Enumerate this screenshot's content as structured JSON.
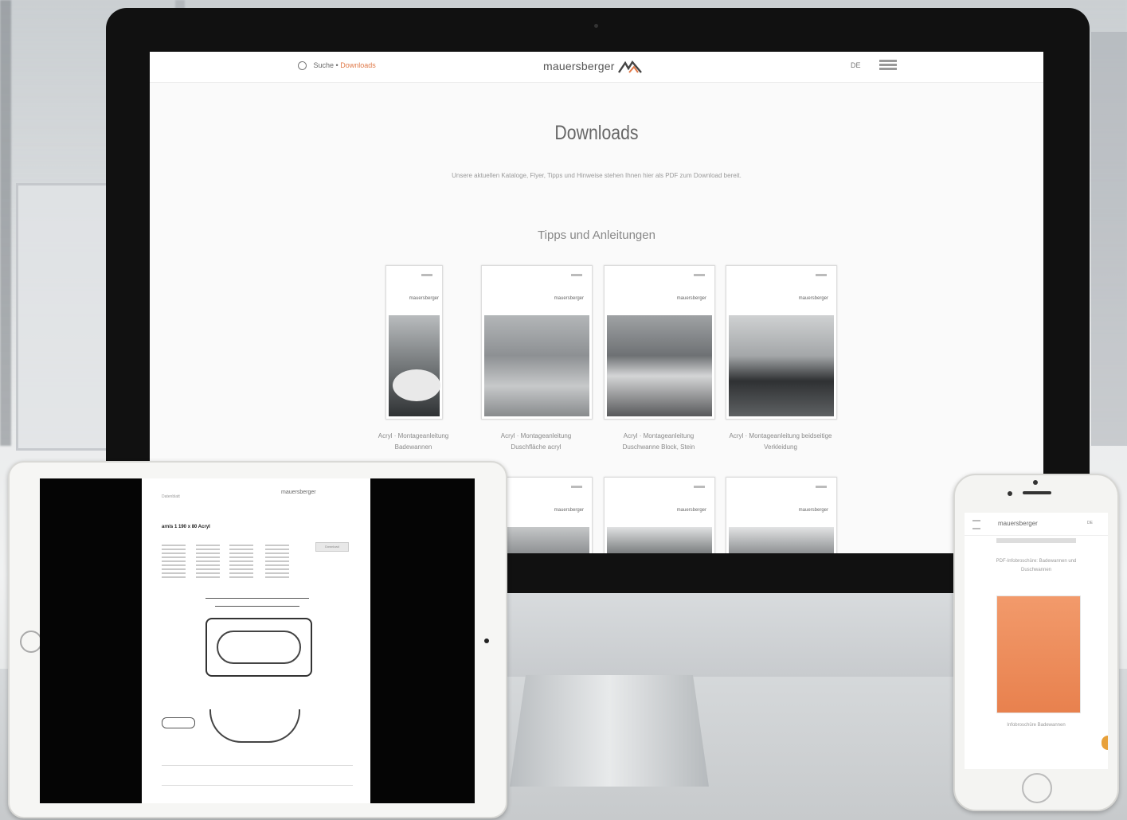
{
  "desktop": {
    "nav": {
      "search_label": "Suche",
      "crumb_sep": " • ",
      "crumb_current": "Downloads",
      "logo_text": "mauersberger",
      "lang": "DE"
    },
    "page_title": "Downloads",
    "page_subtitle": "Unsere aktuellen Kataloge, Flyer, Tipps und Hinweise stehen Ihnen hier als PDF zum Download bereit.",
    "section_title": "Tipps und Anleitungen",
    "cards": [
      {
        "label": "Acryl · Montageanleitung Badewannen"
      },
      {
        "label": "Acryl · Montageanleitung Duschfläche acryl"
      },
      {
        "label": "Acryl · Montageanleitung Duschwanne Block, Stein"
      },
      {
        "label": "Acryl · Montageanleitung beidseitige Verkleidung"
      }
    ],
    "card_brand": "mauersberger"
  },
  "tablet": {
    "pdf_header": "Datenblatt",
    "pdf_logo": "mauersberger",
    "pdf_title": "arnis 1 190 x 80 Acryl",
    "pdf_button": "Download"
  },
  "phone": {
    "logo_text": "mauersberger",
    "lang": "DE",
    "intro_text": "PDF-Infobroschüre: Badewannen und Duschwannen",
    "cover_label": "Infobroschüre Badewannen"
  }
}
